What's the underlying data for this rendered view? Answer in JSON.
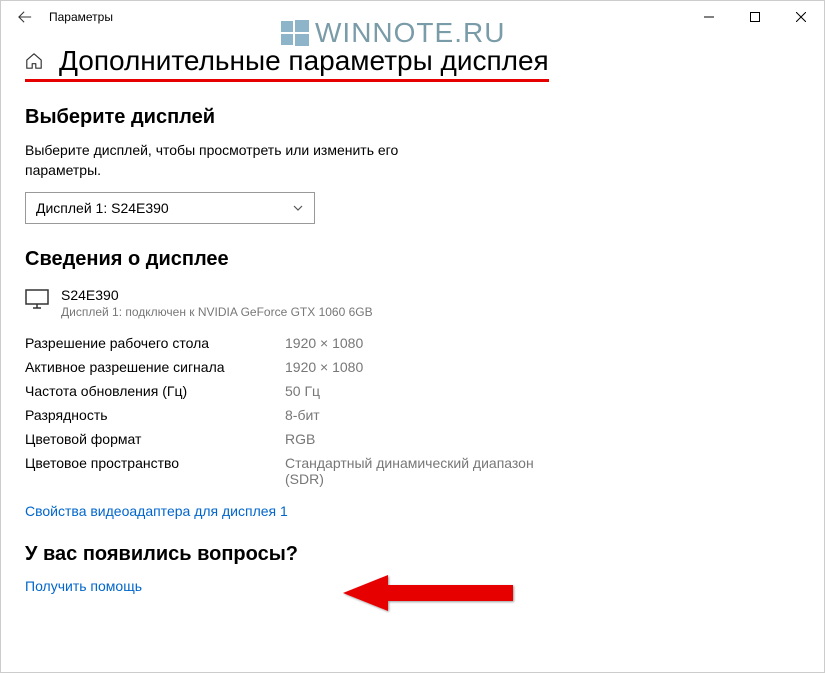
{
  "window": {
    "title": "Параметры"
  },
  "watermark": {
    "text": "WINNOTE.RU"
  },
  "page": {
    "title": "Дополнительные параметры дисплея"
  },
  "select_display": {
    "heading": "Выберите дисплей",
    "description": "Выберите дисплей, чтобы просмотреть или изменить его параметры.",
    "dropdown_value": "Дисплей 1: S24E390"
  },
  "display_info": {
    "heading": "Сведения о дисплее",
    "name": "S24E390",
    "subtitle": "Дисплей 1: подключен к NVIDIA GeForce GTX 1060 6GB",
    "rows": [
      {
        "label": "Разрешение рабочего стола",
        "value": "1920 × 1080"
      },
      {
        "label": "Активное разрешение сигнала",
        "value": "1920 × 1080"
      },
      {
        "label": "Частота обновления (Гц)",
        "value": "50 Гц"
      },
      {
        "label": "Разрядность",
        "value": "8-бит"
      },
      {
        "label": "Цветовой формат",
        "value": "RGB"
      },
      {
        "label": "Цветовое пространство",
        "value": "Стандартный динамический диапазон (SDR)"
      }
    ],
    "adapter_link": "Свойства видеоадаптера для дисплея 1"
  },
  "questions": {
    "heading": "У вас появились вопросы?",
    "help_link": "Получить помощь"
  }
}
